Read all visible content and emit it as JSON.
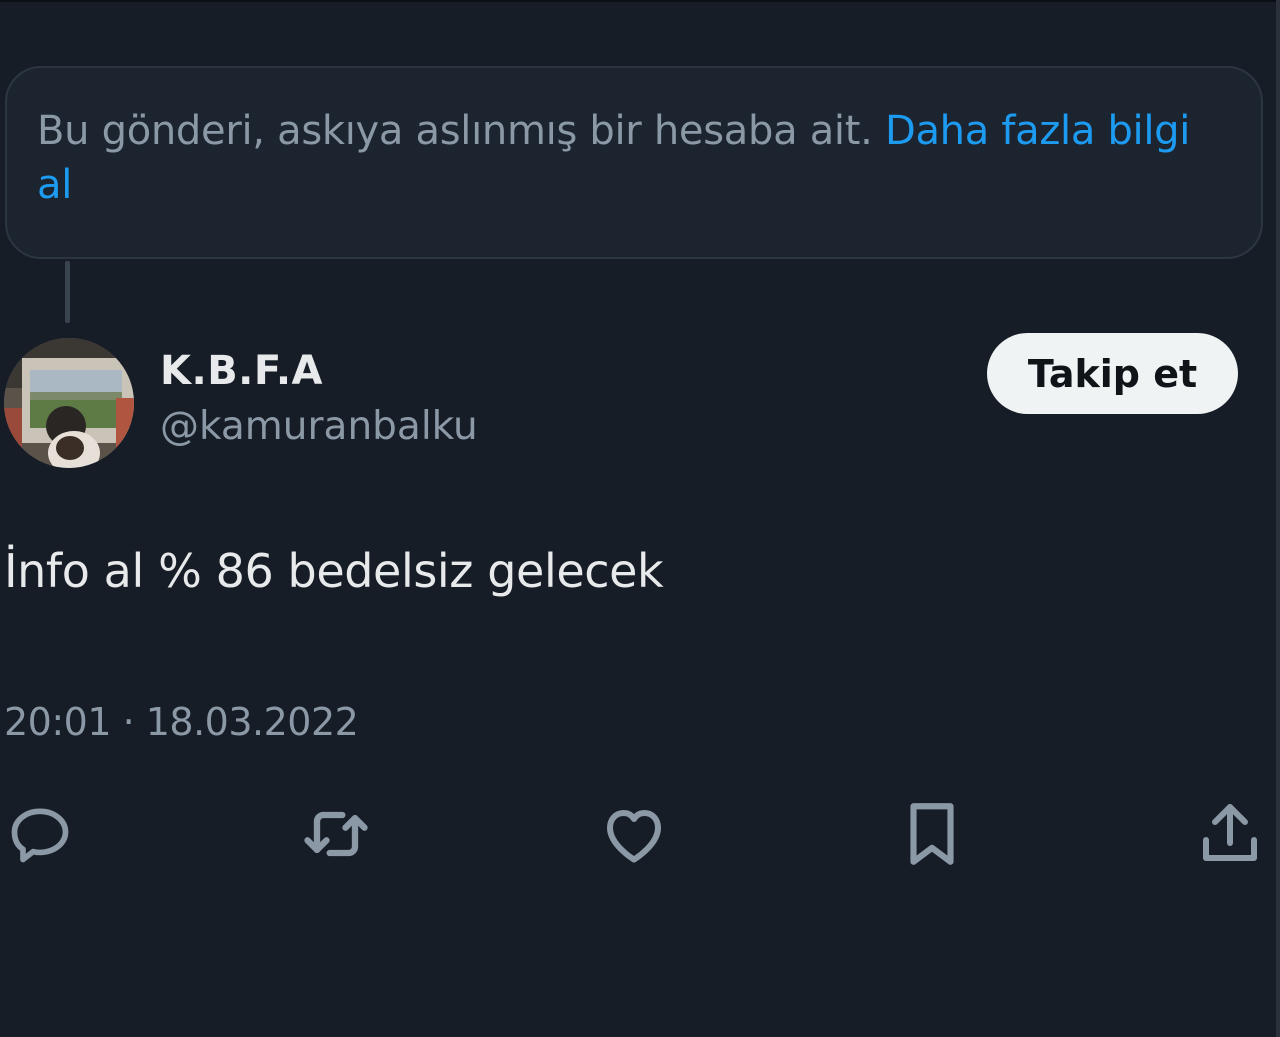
{
  "notice": {
    "text": "Bu gönderi, askıya aslınmış bir hesaba ait. ",
    "link_label": "Daha fazla bilgi al"
  },
  "author": {
    "display_name": "K.B.F.A",
    "handle": "@kamuranbalku"
  },
  "follow_button": {
    "label": "Takip et"
  },
  "tweet": {
    "text": "İnfo al % 86 bedelsiz gelecek",
    "timestamp": "20:01 · 18.03.2022"
  },
  "actions": [
    {
      "icon": "reply-icon"
    },
    {
      "icon": "retweet-icon"
    },
    {
      "icon": "like-icon"
    },
    {
      "icon": "bookmark-icon"
    },
    {
      "icon": "share-icon"
    }
  ],
  "colors": {
    "background": "#161d27",
    "primary_text": "#e7e9ea",
    "secondary_text": "#8b98a5",
    "link": "#1d9bf0",
    "button_bg": "#eff3f4"
  }
}
